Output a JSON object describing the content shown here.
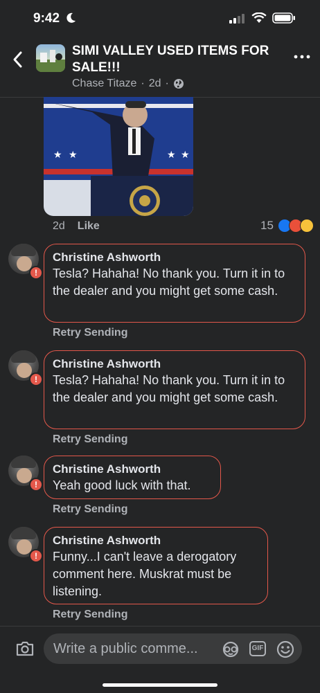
{
  "status_bar": {
    "time": "9:42"
  },
  "header": {
    "title": "SIMI VALLEY USED ITEMS FOR SALE!!!",
    "author": "Chase Titaze",
    "age": "2d",
    "separator": "·"
  },
  "post": {
    "age": "2d",
    "like_label": "Like",
    "reaction_count": "15",
    "reaction_icons": [
      "like-icon",
      "angry-icon",
      "wow-icon"
    ]
  },
  "comments": [
    {
      "author": "Christine Ashworth",
      "text": "Tesla? Hahaha! No thank you. Turn it in to the dealer and you might get some cash.",
      "retry_label": "Retry Sending",
      "error_glyph": "!"
    },
    {
      "author": "Christine Ashworth",
      "text": "Tesla? Hahaha! No thank you. Turn it in to the dealer and you might get some cash.",
      "retry_label": "Retry Sending",
      "error_glyph": "!"
    },
    {
      "author": "Christine Ashworth",
      "text": "Yeah good luck with that.",
      "retry_label": "Retry Sending",
      "error_glyph": "!"
    },
    {
      "author": "Christine Ashworth",
      "text": "Funny...I can't leave a derogatory comment here. Muskrat must be listening.",
      "retry_label": "Retry Sending",
      "error_glyph": "!"
    }
  ],
  "composer": {
    "placeholder": "Write a public comme...",
    "gif_label": "GIF"
  },
  "colors": {
    "background": "#242526",
    "error": "#e4584b",
    "secondary_text": "#b0b3b8",
    "like_blue": "#1877f2"
  }
}
